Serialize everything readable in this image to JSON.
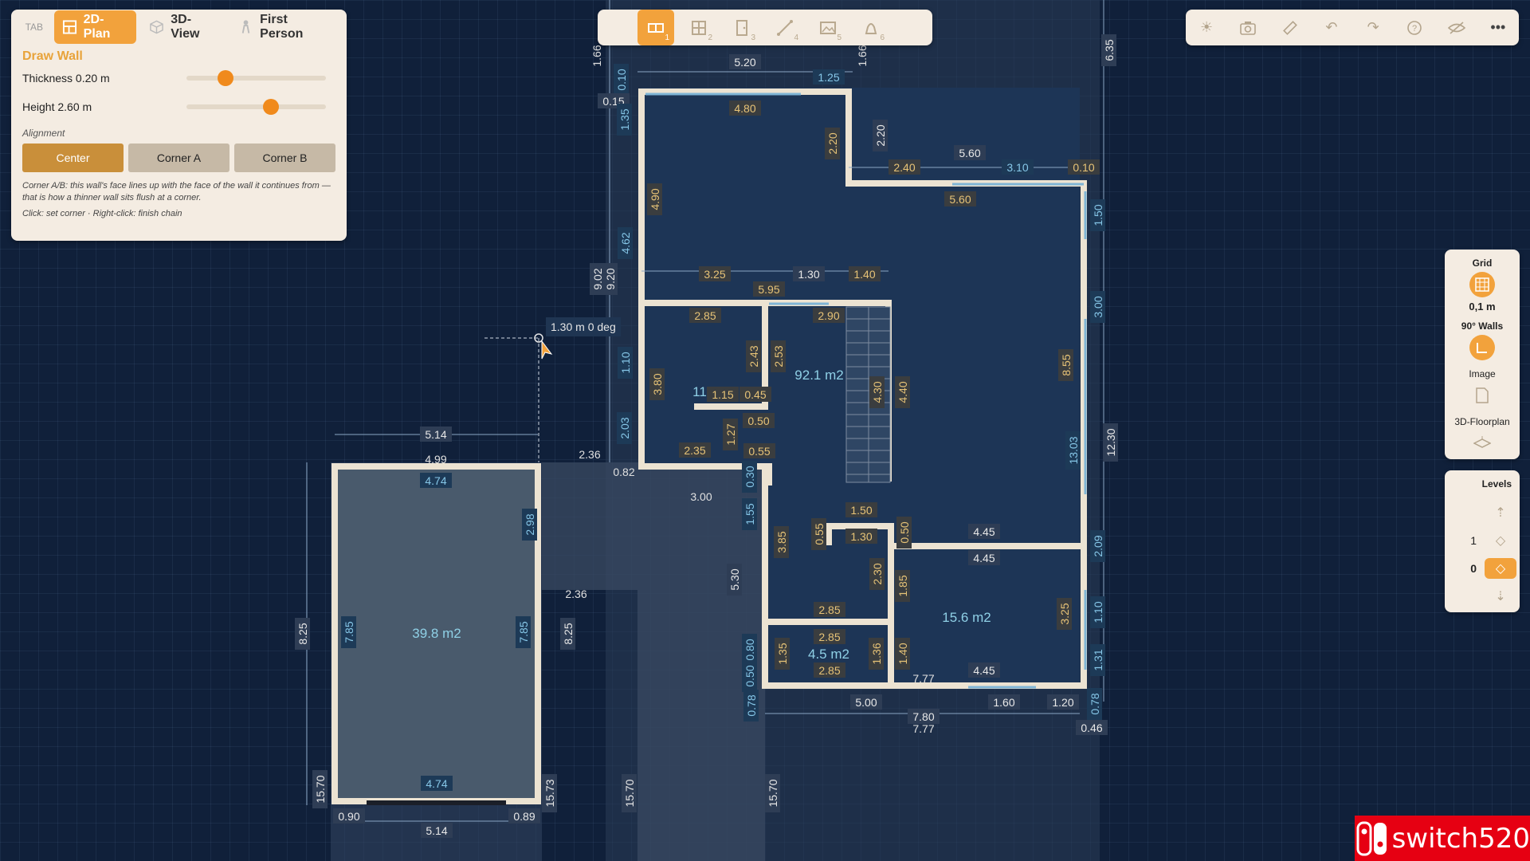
{
  "tabs": {
    "key_hint": "TAB",
    "items": [
      {
        "label": "2D-Plan",
        "icon": "floorplan-icon",
        "active": true
      },
      {
        "label": "3D-View",
        "icon": "cube-icon",
        "active": false
      },
      {
        "label": "First Person",
        "icon": "person-icon",
        "active": false
      }
    ]
  },
  "wall_panel": {
    "title": "Draw Wall",
    "thickness_label": "Thickness",
    "thickness_value": "0.20 m",
    "thickness_level": 0.25,
    "height_label": "Height",
    "height_value": "2.60 m",
    "height_level": 0.62,
    "alignment_label": "Alignment",
    "buttons": [
      {
        "label": "Center",
        "active": true
      },
      {
        "label": "Corner A",
        "active": false
      },
      {
        "label": "Corner B",
        "active": false
      }
    ],
    "note": "Corner A/B: this wall's face lines up with the face of the wall it continues from — that is how a thinner wall sits flush at a corner.",
    "hint": "Click: set corner · Right-click: finish chain"
  },
  "toolbar": {
    "tools": [
      {
        "num": "1",
        "icon": "wall-tool-icon",
        "active": true
      },
      {
        "num": "2",
        "icon": "window-tool-icon",
        "active": false
      },
      {
        "num": "3",
        "icon": "door-tool-icon",
        "active": false
      },
      {
        "num": "4",
        "icon": "measure-tool-icon",
        "active": false
      },
      {
        "num": "5",
        "icon": "image-tool-icon",
        "active": false
      },
      {
        "num": "6",
        "icon": "furniture-tool-icon",
        "active": false
      }
    ]
  },
  "right_toolbar": {
    "icons": [
      "sun-icon",
      "camera-icon",
      "ruler-icon",
      "undo-icon",
      "redo-icon",
      "help-icon",
      "hide-icon",
      "more-icon"
    ]
  },
  "side_panel": {
    "grid_label": "Grid",
    "grid_value": "0,1 m",
    "walls_label": "90° Walls",
    "image_label": "Image",
    "floorplan_label": "3D-Floorplan"
  },
  "levels_panel": {
    "title": "Levels",
    "levels": [
      {
        "num": "1",
        "active": false
      },
      {
        "num": "0",
        "active": true
      }
    ]
  },
  "cursor_tip": "1.30 m  0 deg",
  "rooms": [
    {
      "label": "39.8 m2"
    },
    {
      "label": "92.1 m2"
    },
    {
      "label": "15.6 m2"
    },
    {
      "label": "4.5 m2"
    },
    {
      "label": "11"
    }
  ],
  "dimension_labels": [
    "5.20",
    "1.25",
    "0.10",
    "0.15",
    "4.80",
    "1.35",
    "2.20",
    "2.20",
    "4.90",
    "5.60",
    "2.40",
    "3.10",
    "0.10",
    "5.60",
    "1.50",
    "4.62",
    "9.20",
    "9.02",
    "3.25",
    "1.30",
    "1.40",
    "5.95",
    "2.85",
    "2.90",
    "3.00",
    "2.43",
    "2.53",
    "1.10",
    "3.80",
    "4.30",
    "4.40",
    "8.55",
    "1.15",
    "0.45",
    "0.50",
    "1.27",
    "2.03",
    "2.35",
    "0.55",
    "5.14",
    "4.99",
    "4.74",
    "2.36",
    "0.82",
    "3.00",
    "2.98",
    "13.03",
    "12.30",
    "0.30",
    "1.55",
    "1.50",
    "0.55",
    "1.30",
    "0.50",
    "4.45",
    "4.45",
    "3.85",
    "2.09",
    "7.85",
    "39.8",
    "7.85",
    "8.25",
    "8.25",
    "5.30",
    "2.30",
    "1.85",
    "2.85",
    "3.25",
    "1.10",
    "2.85",
    "1.35",
    "1.36",
    "1.40",
    "0.80",
    "2.85",
    "7.77",
    "4.45",
    "1.31",
    "0.50",
    "2.36",
    "0.78",
    "5.00",
    "1.60",
    "1.20",
    "0.78",
    "7.80",
    "7.77",
    "0.46",
    "15.70",
    "15.73",
    "4.74",
    "0.90",
    "0.89",
    "5.14",
    "15.70",
    "15.70",
    "6.35",
    "1.66",
    "1.66"
  ],
  "watermark": "switch520"
}
